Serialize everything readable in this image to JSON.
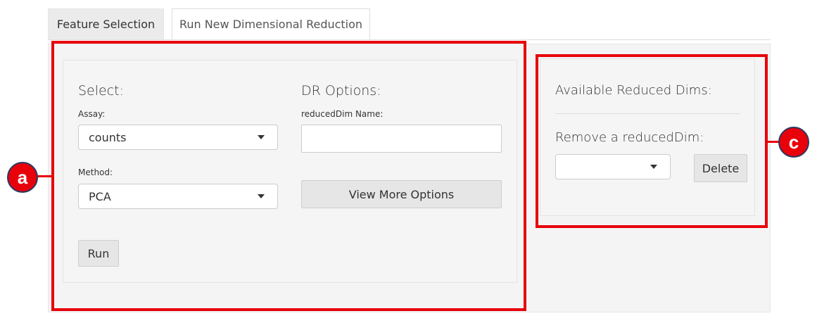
{
  "tabs": [
    {
      "label": "Feature Selection"
    },
    {
      "label": "Run New Dimensional Reduction"
    }
  ],
  "left_panel": {
    "select_heading": "Select:",
    "assay_label": "Assay:",
    "assay_value": "counts",
    "method_label": "Method:",
    "method_value": "PCA",
    "run_label": "Run",
    "dr_heading": "DR Options:",
    "reduced_dim_name_label": "reducedDim Name:",
    "reduced_dim_name_value": "",
    "view_more_label": "View More Options"
  },
  "right_panel": {
    "available_heading": "Available Reduced Dims:",
    "remove_heading": "Remove a reducedDim:",
    "remove_select_value": "",
    "delete_label": "Delete"
  },
  "annotations": {
    "label_a": "a",
    "label_c": "c",
    "color": "#e8000b"
  }
}
